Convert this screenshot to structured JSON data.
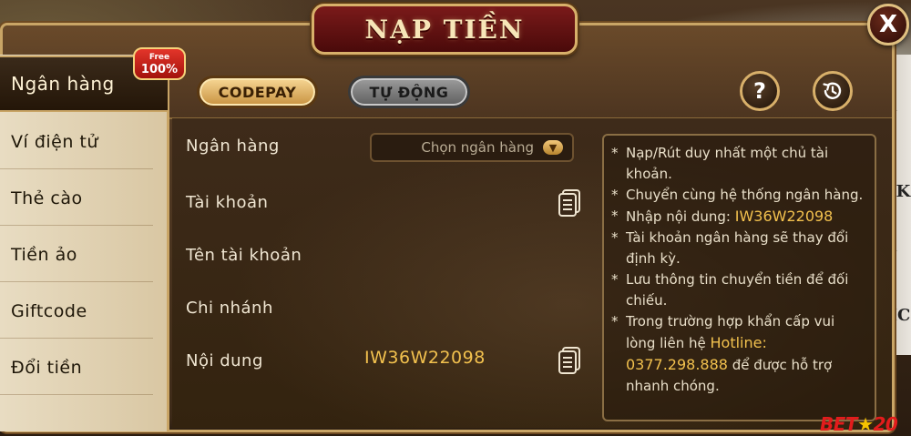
{
  "window": {
    "title": "NẠP TIỀN",
    "close_label": "X"
  },
  "sidebar": {
    "items": [
      {
        "label": "Ngân hàng",
        "active": true
      },
      {
        "label": "Ví điện tử",
        "active": false
      },
      {
        "label": "Thẻ cào",
        "active": false
      },
      {
        "label": "Tiền ảo",
        "active": false
      },
      {
        "label": "Giftcode",
        "active": false
      },
      {
        "label": "Đổi tiền",
        "active": false
      }
    ],
    "badge": {
      "line1": "Free",
      "line2": "100%"
    }
  },
  "tabs": [
    {
      "label": "CODEPAY",
      "selected": true
    },
    {
      "label": "TỰ ĐỘNG",
      "selected": false
    }
  ],
  "toolbar": {
    "help_label": "?",
    "help_icon": "question-icon",
    "history_icon": "history-icon"
  },
  "form": {
    "bank_label": "Ngân hàng",
    "bank_placeholder": "Chọn ngân hàng",
    "account_label": "Tài khoản",
    "account_name_label": "Tên tài khoản",
    "branch_label": "Chi nhánh",
    "content_label": "Nội dung",
    "content_value": "IW36W22098"
  },
  "info": {
    "item1": "Nạp/Rút duy nhất một chủ tài khoản.",
    "item2": "Chuyển cùng hệ thống ngân hàng.",
    "item3_prefix": "Nhập nội dung:",
    "item3_code": "IW36W22098",
    "item4": "Tài khoản ngân hàng sẽ thay đổi định kỳ.",
    "item5": "Lưu thông tin chuyển tiền để đối chiếu.",
    "item6_prefix": "Trong trường hợp khẩn cấp vui lòng liên hệ",
    "item6_hotline_label": "Hotline:",
    "item6_hotline_number": "0377.298.888",
    "item6_suffix": "để được hỗ trợ nhanh chóng."
  },
  "brand": {
    "logo_left": "BET",
    "logo_right": "20",
    "accent_color": "#f2c14e",
    "active_tab_color": "#f7d795"
  }
}
